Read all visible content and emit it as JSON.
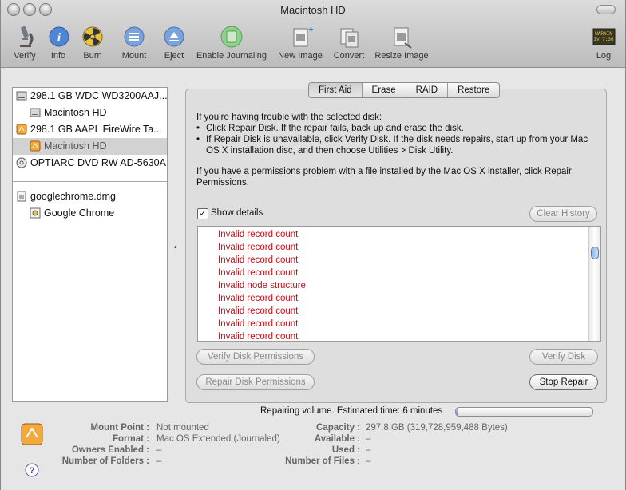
{
  "window": {
    "title": "Macintosh HD"
  },
  "toolbar": {
    "items": [
      {
        "label": "Verify",
        "icon": "microscope-icon"
      },
      {
        "label": "Info",
        "icon": "info-icon"
      },
      {
        "label": "Burn",
        "icon": "burn-icon"
      },
      {
        "label": "Mount",
        "icon": "mount-icon"
      },
      {
        "label": "Eject",
        "icon": "eject-icon"
      },
      {
        "label": "Enable Journaling",
        "icon": "journaling-icon"
      },
      {
        "label": "New Image",
        "icon": "new-image-icon"
      },
      {
        "label": "Convert",
        "icon": "convert-icon"
      },
      {
        "label": "Resize Image",
        "icon": "resize-image-icon"
      },
      {
        "label": "Log",
        "icon": "log-icon",
        "badge": "WARNIN\nIV 7:36"
      }
    ]
  },
  "sidebar": {
    "items": [
      {
        "label": "298.1 GB WDC WD3200AAJ...",
        "icon": "hard-disk-icon"
      },
      {
        "label": "Macintosh HD",
        "icon": "volume-icon"
      },
      {
        "label": "298.1 GB AAPL FireWire Ta...",
        "icon": "firewire-disk-icon"
      },
      {
        "label": "Macintosh HD",
        "icon": "firewire-volume-icon",
        "selected": true
      },
      {
        "label": "OPTIARC DVD RW AD-5630A",
        "icon": "dvd-icon"
      },
      {
        "label": "googlechrome.dmg",
        "icon": "dmg-icon"
      },
      {
        "label": "Google Chrome",
        "icon": "chrome-volume-icon"
      }
    ]
  },
  "tabs": [
    "First Aid",
    "Erase",
    "RAID",
    "Restore"
  ],
  "active_tab": "First Aid",
  "first_aid": {
    "intro": "If you’re having trouble with the selected disk:",
    "bullet1": "Click Repair Disk. If the repair fails, back up and erase the disk.",
    "bullet2": "If Repair Disk is unavailable, click Verify Disk. If the disk needs repairs, start up from your Mac OS X installation disc, and then choose Utilities > Disk Utility.",
    "permissions": "If you have a permissions problem with a file installed by the Mac OS X installer, click Repair Permissions.",
    "show_details_label": "Show details",
    "show_details_checked": true,
    "clear_history": "Clear History",
    "log_lines": [
      "Invalid record count",
      "Invalid record count",
      "Invalid record count",
      "Invalid record count",
      "Invalid node structure",
      "Invalid record count",
      "Invalid record count",
      "Invalid record count",
      "Invalid record count"
    ],
    "verify_permissions": "Verify Disk Permissions",
    "verify_disk": "Verify Disk",
    "repair_permissions": "Repair Disk Permissions",
    "stop_repair": "Stop Repair"
  },
  "status": {
    "text": "Repairing volume. Estimated time: 6 minutes",
    "progress": 0.02
  },
  "info": {
    "mount_point_label": "Mount Point :",
    "mount_point": "Not mounted",
    "format_label": "Format :",
    "format": "Mac OS Extended (Journaled)",
    "owners_label": "Owners Enabled :",
    "owners": "–",
    "folders_label": "Number of Folders :",
    "folders": "–",
    "capacity_label": "Capacity :",
    "capacity": "297.8 GB (319,728,959,488 Bytes)",
    "available_label": "Available :",
    "available": "–",
    "used_label": "Used :",
    "used": "–",
    "files_label": "Number of Files :",
    "files": "–"
  },
  "colors": {
    "error_text": "#c1121b",
    "progress": "#5c8dd0"
  }
}
